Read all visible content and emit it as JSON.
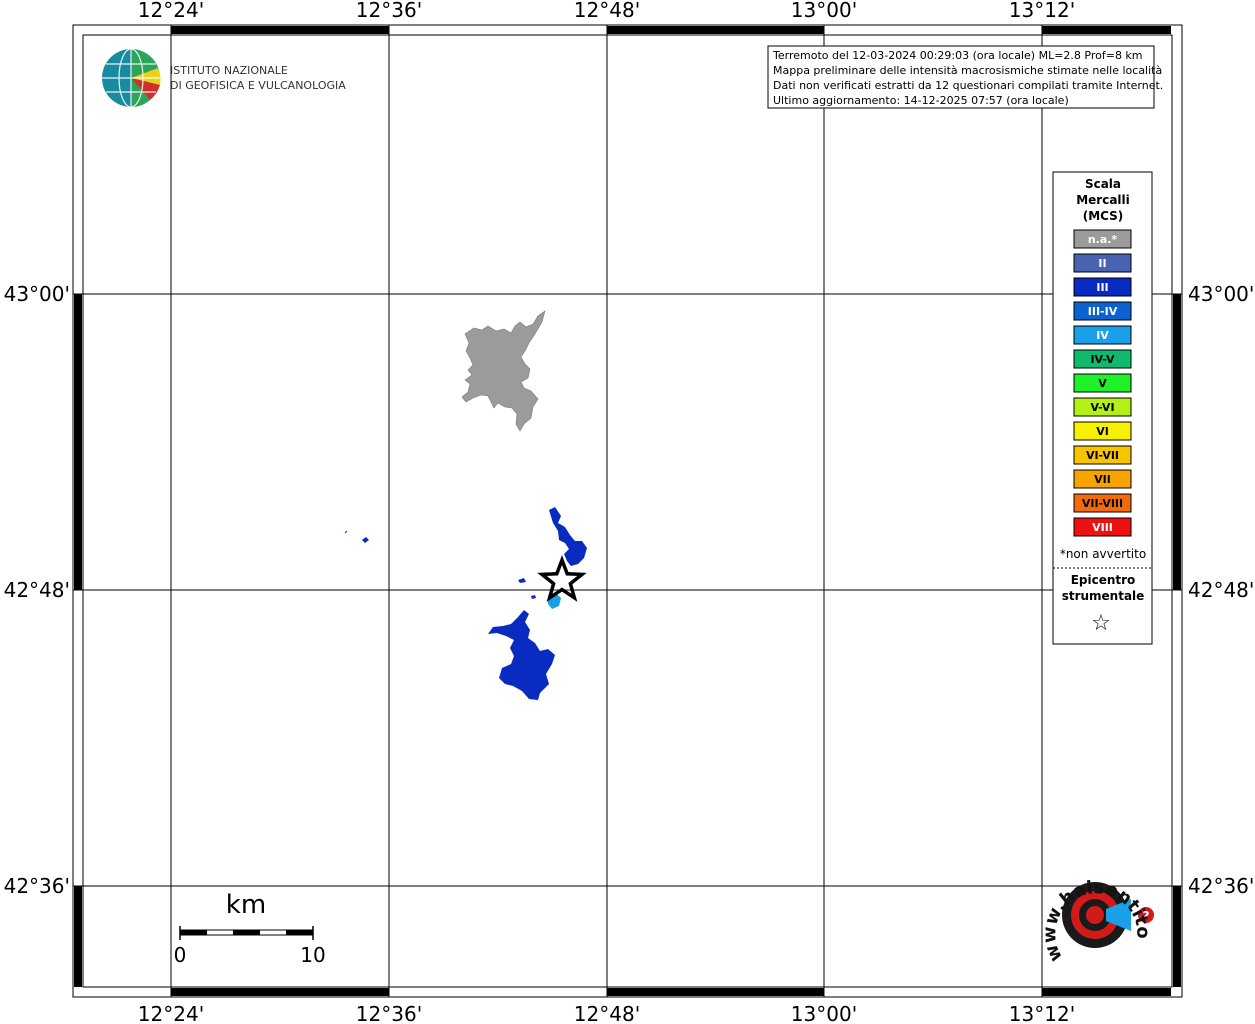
{
  "map": {
    "lon_ticks": [
      "12°24'",
      "12°36'",
      "12°48'",
      "13°00'",
      "13°12'"
    ],
    "lat_ticks": [
      "43°00'",
      "42°48'",
      "42°36'"
    ]
  },
  "logo": {
    "line1": "ISTITUTO NAZIONALE",
    "line2": "DI GEOFISICA E VULCANOLOGIA"
  },
  "info_box": {
    "lines": [
      "Terremoto del 12-03-2024 00:29:03 (ora locale) ML=2.8 Prof=8 km",
      "Mappa preliminare delle intensità macrosismiche stimate nelle località",
      "Dati non verificati estratti da 12 questionari compilati tramite Internet.",
      "Ultimo aggiornamento: 14-12-2025 07:57 (ora locale)"
    ]
  },
  "legend": {
    "title_lines": [
      "Scala",
      "Mercalli",
      "(MCS)"
    ],
    "items": [
      {
        "label": "n.a.*",
        "color": "#9b9b9b",
        "text_color": "#ffffff"
      },
      {
        "label": "II",
        "color": "#4a63b0",
        "text_color": "#ffffff"
      },
      {
        "label": "III",
        "color": "#0a2bbf",
        "text_color": "#ffffff"
      },
      {
        "label": "III-IV",
        "color": "#0a63d0",
        "text_color": "#ffffff"
      },
      {
        "label": "IV",
        "color": "#1aa0e8",
        "text_color": "#ffffff"
      },
      {
        "label": "IV-V",
        "color": "#0fb96e",
        "text_color": "#000000"
      },
      {
        "label": "V",
        "color": "#1ef02a",
        "text_color": "#000000"
      },
      {
        "label": "V-VI",
        "color": "#b4f015",
        "text_color": "#000000"
      },
      {
        "label": "VI",
        "color": "#f7f000",
        "text_color": "#000000"
      },
      {
        "label": "VI-VII",
        "color": "#f7c400",
        "text_color": "#000000"
      },
      {
        "label": "VII",
        "color": "#f7a300",
        "text_color": "#000000"
      },
      {
        "label": "VII-VIII",
        "color": "#f26a0a",
        "text_color": "#000000"
      },
      {
        "label": "VIII",
        "color": "#ee1111",
        "text_color": "#ffffff"
      }
    ],
    "note": "*non avvertito",
    "epicenter_lines": [
      "Epicentro",
      "strumentale"
    ],
    "epicenter_symbol": "☆"
  },
  "scale_bar": {
    "unit": "km",
    "min_label": "0",
    "max_label": "10"
  },
  "watermark": {
    "text": "www.haisentitoilterremoto.it"
  },
  "features": {
    "epicenter": {
      "name": "epicentro-strumentale",
      "intensity": null
    },
    "areas": [
      {
        "name": "area-gray",
        "intensity": "n.a.*",
        "color": "#9b9b9b"
      },
      {
        "name": "area-iii-north",
        "intensity": "III",
        "color": "#0a2bbf"
      },
      {
        "name": "area-iii-south",
        "intensity": "III",
        "color": "#0a2bbf"
      },
      {
        "name": "area-iv",
        "intensity": "IV",
        "color": "#1aa0e8"
      },
      {
        "name": "area-iii-west",
        "intensity": "III",
        "color": "#0a2bbf"
      }
    ]
  }
}
